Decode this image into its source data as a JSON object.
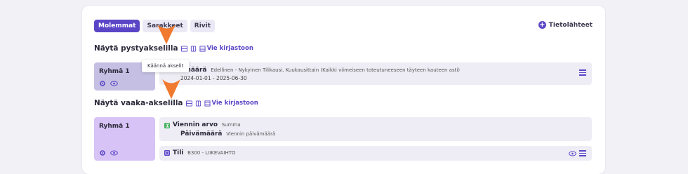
{
  "toggle": {
    "opt1": "Molemmat",
    "opt2": "Sarakkeet",
    "opt3": "Rivit"
  },
  "sources_link": "Tietolähteet",
  "vertical": {
    "title": "Näytä pystyakselilla",
    "link": "Vie kirjastoon",
    "group_label": "Ryhmä 1",
    "row_title": "Päivämäärä",
    "row_desc": "Edellinen - Nykyinen Tilikausi, Kuukausittain (Kaikki viimeiseen toteutuneeseen täyteen kauteen asti)",
    "row_date": "2024-01-01 - 2025-06-30"
  },
  "tooltip": "Käännä akselit",
  "horizontal": {
    "title": "Näytä vaaka-akselilla",
    "link": "Vie kirjastoon",
    "group_label": "Ryhmä 1",
    "value_title": "Viennin arvo",
    "value_sub": "Summa",
    "date_title": "Päivämäärä",
    "date_sub": "Viennin päivämäärä",
    "account_title": "Tili",
    "account_sub": "B300 - LIIKEVAIHTO"
  },
  "colors": {
    "accent": "#5b45c7",
    "group_vertical": "#c5c0e3",
    "group_horizontal": "#d7c3f5",
    "arrow": "#f07a30"
  }
}
